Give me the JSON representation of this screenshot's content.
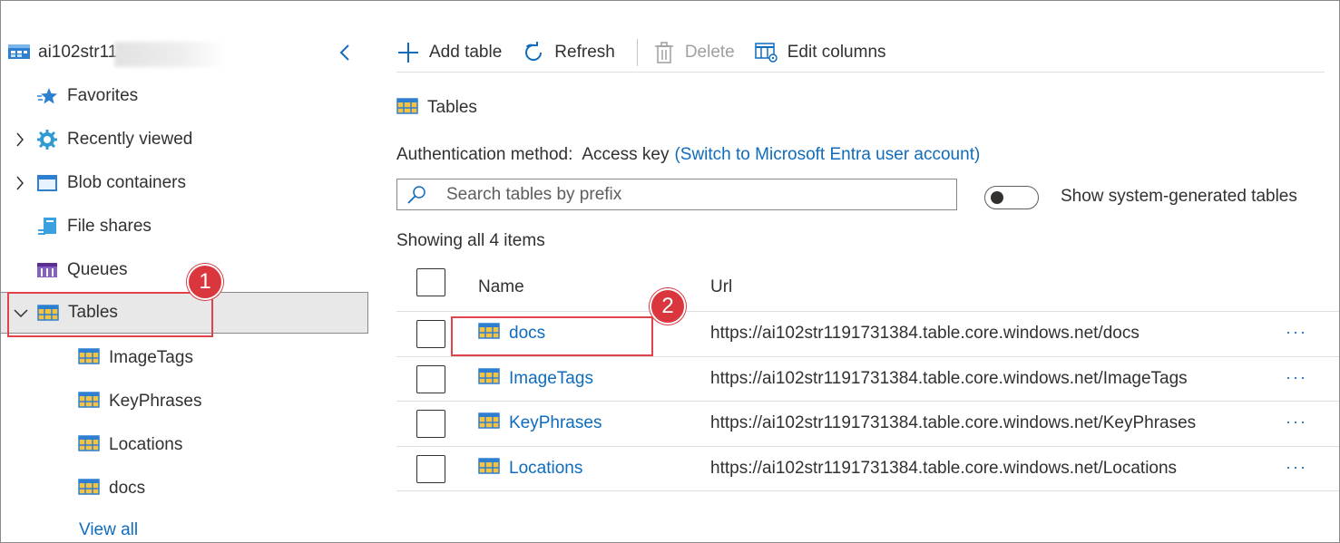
{
  "tree": {
    "account_name": "ai102str11",
    "collapse_glyph": "‹",
    "items": [
      {
        "label": "Favorites",
        "icon": "star-icon",
        "caret": false
      },
      {
        "label": "Recently viewed",
        "icon": "gear-icon",
        "caret": true
      },
      {
        "label": "Blob containers",
        "icon": "blob-icon",
        "caret": true
      },
      {
        "label": "File shares",
        "icon": "file-share-icon",
        "caret": false
      },
      {
        "label": "Queues",
        "icon": "queue-icon",
        "caret": false
      },
      {
        "label": "Tables",
        "icon": "table-icon",
        "caret": true,
        "expanded": true
      }
    ],
    "children": [
      "ImageTags",
      "KeyPhrases",
      "Locations",
      "docs"
    ],
    "view_all": "View all"
  },
  "annotations": {
    "badge_1": "1",
    "badge_2": "2"
  },
  "toolbar": {
    "add_table": "Add table",
    "refresh": "Refresh",
    "delete": "Delete",
    "edit_columns": "Edit columns"
  },
  "section_title": "Tables",
  "auth": {
    "label": "Authentication method:",
    "value": "Access key",
    "switch_link": "(Switch to Microsoft Entra user account)"
  },
  "search": {
    "placeholder": "Search tables by prefix",
    "value": ""
  },
  "toggle": {
    "label": "Show system-generated tables",
    "on": false
  },
  "count_text": "Showing all 4 items",
  "grid": {
    "headers": {
      "name": "Name",
      "url": "Url"
    },
    "rows": [
      {
        "name": "docs",
        "url": "https://ai102str1191731384.table.core.windows.net/docs"
      },
      {
        "name": "ImageTags",
        "url": "https://ai102str1191731384.table.core.windows.net/ImageTags"
      },
      {
        "name": "KeyPhrases",
        "url": "https://ai102str1191731384.table.core.windows.net/KeyPhrases"
      },
      {
        "name": "Locations",
        "url": "https://ai102str1191731384.table.core.windows.net/Locations"
      }
    ],
    "more_glyph": "···"
  },
  "colors": {
    "accent": "#0f6cbd",
    "callout": "#e0434b",
    "badge": "#d9363e",
    "selected_bg": "#e8e8e8"
  }
}
